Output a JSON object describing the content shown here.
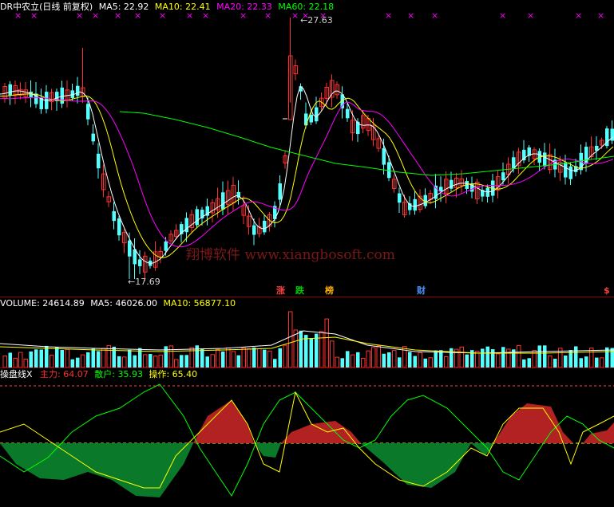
{
  "main": {
    "stock_title": "DR中农立(日线 前复权)",
    "ma5": "MA5: 22.92",
    "ma10": "MA10: 22.41",
    "ma20": "MA20: 22.33",
    "ma60": "MA60: 22.18",
    "high_label": "27.63",
    "low_label": "17.69",
    "watermark": "翔博软件 www.xiangbosoft.com",
    "cross_marks": [
      "×",
      "×",
      "×",
      "×",
      "×",
      "×",
      "×",
      "×",
      "×",
      "×",
      "×",
      "×",
      "×",
      "×",
      "×",
      "×",
      "×",
      "×",
      "×",
      "×",
      "×"
    ],
    "events": [
      {
        "text": "涨",
        "color": "#ff4040"
      },
      {
        "text": "跌",
        "color": "#00d000"
      },
      {
        "text": "榜",
        "color": "#ffb000"
      },
      {
        "text": "财",
        "color": "#4a90ff"
      },
      {
        "text": "$",
        "color": "#ff4040"
      }
    ]
  },
  "volume": {
    "title": "VOLUME: 24614.89",
    "ma5": "MA5: 46026.00",
    "ma10": "MA10: 56877.10"
  },
  "indicator": {
    "name": "操盘线X",
    "zhuli": "主力: 64.07",
    "sanhu": "散户: 35.93",
    "caozuo": "操作: 65.40"
  },
  "colors": {
    "up": "#ff3030",
    "down": "#54ffff",
    "ma5": "#ffffff",
    "ma10": "#ffff00",
    "ma20": "#ff00ff",
    "ma60": "#00ff00",
    "fill_red": "#b22222",
    "fill_green": "#0a7a2a",
    "separator": "#8b0000"
  }
}
